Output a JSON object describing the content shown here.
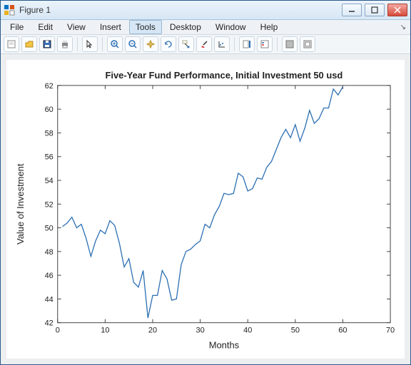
{
  "window": {
    "title": "Figure 1"
  },
  "menu": [
    "File",
    "Edit",
    "View",
    "Insert",
    "Tools",
    "Desktop",
    "Window",
    "Help"
  ],
  "chart_data": {
    "type": "line",
    "title": "Five-Year Fund Performance, Initial Investment 50 usd",
    "xlabel": "Months",
    "ylabel": "Value of Investment",
    "xlim": [
      0,
      70
    ],
    "ylim": [
      42,
      62
    ],
    "xticks": [
      0,
      10,
      20,
      30,
      40,
      50,
      60,
      70
    ],
    "yticks": [
      42,
      44,
      46,
      48,
      50,
      52,
      54,
      56,
      58,
      60,
      62
    ],
    "x": [
      1,
      2,
      3,
      4,
      5,
      6,
      7,
      8,
      9,
      10,
      11,
      12,
      13,
      14,
      15,
      16,
      17,
      18,
      19,
      20,
      21,
      22,
      23,
      24,
      25,
      26,
      27,
      28,
      29,
      30,
      31,
      32,
      33,
      34,
      35,
      36,
      37,
      38,
      39,
      40,
      41,
      42,
      43,
      44,
      45,
      46,
      47,
      48,
      49,
      50,
      51,
      52,
      53,
      54,
      55,
      56,
      57,
      58,
      59,
      60
    ],
    "values": [
      50.1,
      50.4,
      50.9,
      50.0,
      50.3,
      49.1,
      47.6,
      48.9,
      49.8,
      49.5,
      50.6,
      50.2,
      48.7,
      46.7,
      47.4,
      45.4,
      45.0,
      46.4,
      42.4,
      44.3,
      44.3,
      46.4,
      45.7,
      43.9,
      44.0,
      46.9,
      48.0,
      48.2,
      48.6,
      48.9,
      50.3,
      50.0,
      51.1,
      51.8,
      52.9,
      52.8,
      52.9,
      54.6,
      54.3,
      53.1,
      53.3,
      54.2,
      54.1,
      55.1,
      55.6,
      56.6,
      57.6,
      58.3,
      57.6,
      58.7,
      57.3,
      58.4,
      59.9,
      58.8,
      59.2,
      60.1,
      60.1,
      61.7,
      61.2,
      61.9
    ]
  }
}
